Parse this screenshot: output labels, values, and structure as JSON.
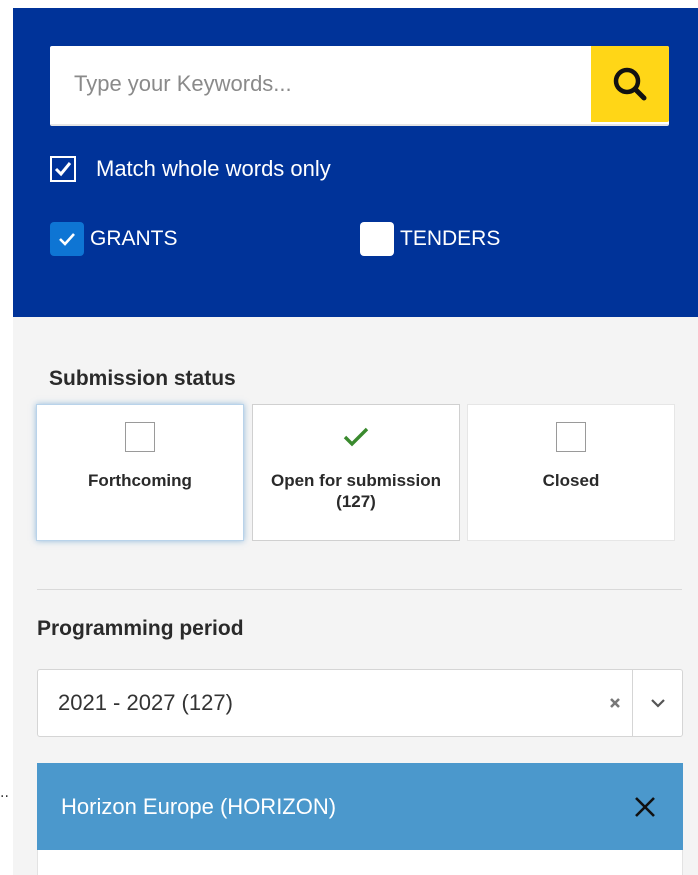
{
  "search": {
    "placeholder": "Type your Keywords...",
    "value": "",
    "button_icon": "search-icon",
    "button_color": "#ffd617"
  },
  "options": {
    "match_whole_words": {
      "label": "Match whole words only",
      "checked": true
    }
  },
  "types": [
    {
      "label": "GRANTS",
      "checked": true
    },
    {
      "label": "TENDERS",
      "checked": false
    }
  ],
  "submission_status": {
    "title": "Submission status",
    "cards": [
      {
        "label": "Forthcoming",
        "selected": false
      },
      {
        "label": "Open for submission (127)",
        "selected": true
      },
      {
        "label": "Closed",
        "selected": false
      }
    ]
  },
  "programming_period": {
    "title": "Programming period",
    "selected": "2021 - 2027 (127)"
  },
  "programme_chip": {
    "label": "Horizon Europe (HORIZON)"
  },
  "left_marker": "..",
  "colors": {
    "panel_blue": "#003399",
    "checkbox_blue": "#0e75d4",
    "chip_blue": "#4b98cc",
    "check_green": "#3a8a2e",
    "filters_bg": "#f4f4f4"
  }
}
